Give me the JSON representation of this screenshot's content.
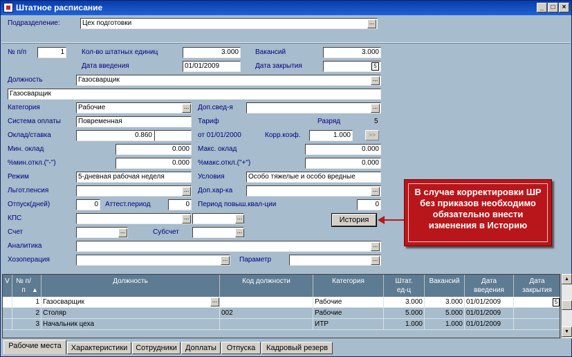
{
  "window": {
    "title": "Штатное расписание",
    "min": "_",
    "max": "□",
    "close": "×"
  },
  "header": {
    "division_label": "Подразделение:",
    "division_value": "Цех подготовки"
  },
  "form": {
    "num_label": "№ п/п",
    "num_value": "1",
    "units_label": "Кол-во штатных единиц",
    "units_value": "3.000",
    "vacancies_label": "Вакансий",
    "vacancies_value": "3.000",
    "intro_date_label": "Дата введения",
    "intro_date_value": "01/01/2009",
    "close_date_label": "Дата закрытия",
    "position_label": "Должность",
    "position_value": "Газосварщик",
    "position_full": "Газосварщик",
    "category_label": "Категория",
    "category_value": "Рабочие",
    "extra_label": "Доп.свед-я",
    "extra_value": "",
    "payment_label": "Система оплаты",
    "payment_value": "Повременная",
    "tariff_label": "Тариф",
    "grade_label": "Разряд",
    "grade_value": "5",
    "salary_label": "Оклад/ставка",
    "salary_value": "0.860",
    "from_label": "от 01/01/2000",
    "corr_label": "Корр.коэф.",
    "corr_value": "1.000",
    "corr_btn": ">>",
    "min_salary_label": "Мин. оклад",
    "min_salary_value": "0.000",
    "max_salary_label": "Макс. оклад",
    "max_salary_value": "0.000",
    "min_dev_label": "%мин.откл.(\"-\")",
    "min_dev_value": "0.000",
    "max_dev_label": "%макс.откл.(\"+\")",
    "max_dev_value": "0.000",
    "mode_label": "Режим",
    "mode_value": "5-дневная рабочая неделя",
    "conditions_label": "Условия",
    "conditions_value": "Особо тяжелые и особо вредные",
    "pension_label": "Льгот.пенсия",
    "pension_value": "",
    "extra_char_label": "Доп.хар-ка",
    "extra_char_value": "",
    "vacation_label": "Отпуск(дней)",
    "vacation_value": "0",
    "attest_label": "Аттест.период",
    "attest_value": "0",
    "qual_label": "Период повыш.квал-ции",
    "qual_value": "0",
    "kps_label": "КПС",
    "history_btn": "История",
    "account_label": "Счет",
    "subaccount_label": "Субсчет",
    "analytics_label": "Аналитика",
    "operation_label": "Хозоперация",
    "param_label": "Параметр",
    "dots": "..."
  },
  "callout": "В случае корректировки ШР без приказов необходимо обязательно внести изменения в Историю",
  "grid": {
    "headers": [
      "V",
      "№ п/п",
      "Должность",
      "Код должности",
      "Категория",
      "Штат. ед-ц",
      "Вакансий",
      "Дата введения",
      "Дата закрытия"
    ],
    "rows": [
      {
        "num": "1",
        "position": "Газосварщик",
        "code": "",
        "category": "Рабочие",
        "units": "3.000",
        "vacancies": "3.000",
        "intro": "01/01/2009"
      },
      {
        "num": "2",
        "position": "Столяр",
        "code": "002",
        "category": "Рабочие",
        "units": "5.000",
        "vacancies": "5.000",
        "intro": "01/01/2009"
      },
      {
        "num": "3",
        "position": "Начальник цеха",
        "code": "",
        "category": "ИТР",
        "units": "1.000",
        "vacancies": "1.000",
        "intro": "01/01/2009"
      }
    ]
  },
  "tabs": [
    "Рабочие места",
    "Характеристики",
    "Сотрудники",
    "Доплаты",
    "Отпуска",
    "Кадровый резерв"
  ],
  "colors": {
    "window_bg": "#a7bccc",
    "title_bar": "#0a3ba8",
    "grid_header": "#5d7b92",
    "callout": "#b8161a",
    "selected_row": "#ffffff"
  }
}
